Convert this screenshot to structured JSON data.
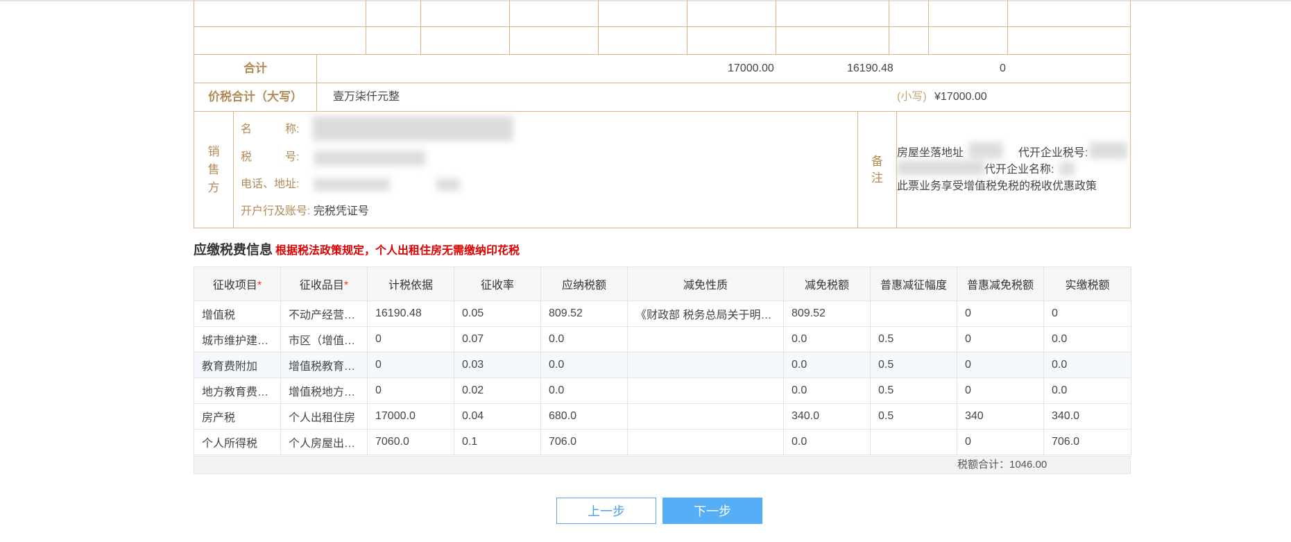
{
  "invoice": {
    "sum_label": "合计",
    "sum_amount": "17000.00",
    "sum_tax_base": "16190.48",
    "sum_tax": "0",
    "total_label": "价税合计（大写）",
    "total_upper": "壹万柒仟元整",
    "total_small_label": "(小写)",
    "total_small": "¥17000.00",
    "seller": {
      "side_chars": [
        "销",
        "售",
        "方"
      ],
      "name_label": "名　　　称:",
      "taxid_label": "税　　　号:",
      "phone_label": "电话、地址:",
      "bank_label": "开户行及账号:",
      "bank_value": "完税凭证号"
    },
    "remark": {
      "side_chars": [
        "备",
        "注"
      ],
      "line1_a": "房屋坐落地址",
      "line1_b": "代开企业税号:",
      "line2": "代开企业名称:",
      "line3": "此票业务享受增值税免税的税收优惠政策"
    }
  },
  "tax_section": {
    "title": "应缴税费信息",
    "note": "根据税法政策规定，个人出租住房无需缴纳印花税",
    "headers": [
      "征收项目",
      "征收品目",
      "计税依据",
      "征收率",
      "应纳税额",
      "减免性质",
      "减免税额",
      "普惠减征幅度",
      "普惠减免税额",
      "实缴税额"
    ],
    "required_mark": "*",
    "rows": [
      [
        "增值税",
        "不动产经营租赁",
        "16190.48",
        "0.05",
        "809.52",
        "《财政部 税务总局关于明确增值税小规模纳税人免征增值税政策的公告》",
        "809.52",
        "",
        "0",
        "0"
      ],
      [
        "城市维护建设税",
        "市区（增值税附征）",
        "0",
        "0.07",
        "0.0",
        "",
        "0.0",
        "0.5",
        "0",
        "0.0"
      ],
      [
        "教育费附加",
        "增值税教育费附加",
        "0",
        "0.03",
        "0.0",
        "",
        "0.0",
        "0.5",
        "0",
        "0.0"
      ],
      [
        "地方教育费附加",
        "增值税地方教育附加",
        "0",
        "0.02",
        "0.0",
        "",
        "0.0",
        "0.5",
        "0",
        "0.0"
      ],
      [
        "房产税",
        "个人出租住房",
        "17000.0",
        "0.04",
        "680.0",
        "",
        "340.0",
        "0.5",
        "340",
        "340.0"
      ],
      [
        "个人所得税",
        "个人房屋出租所得",
        "7060.0",
        "0.1",
        "706.0",
        "",
        "0.0",
        "",
        "0",
        "706.0"
      ]
    ],
    "total_text": "税额合计：1046.00"
  },
  "buttons": {
    "prev": "上一步",
    "next": "下一步"
  },
  "colors": {
    "invoice_line": "#d9b58a",
    "invoice_label": "#b28a55",
    "notice_red": "#e00000",
    "primary_blue": "#56aef6"
  }
}
